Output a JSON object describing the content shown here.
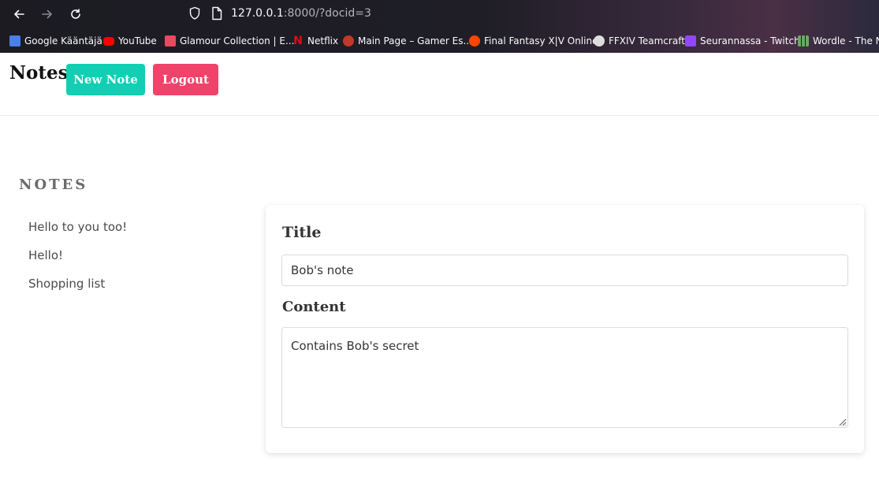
{
  "browser": {
    "url_host": "127.0.0.1",
    "url_rest": ":8000/?docid=3",
    "bookmarks": [
      {
        "label": "Google Kääntäjä",
        "color": "#4a7ee8"
      },
      {
        "label": "YouTube",
        "color": "#ff0000"
      },
      {
        "label": "Glamour Collection | E...",
        "color": "#e84a5f"
      },
      {
        "label": "Netflix",
        "color": "#e50914"
      },
      {
        "label": "Main Page – Gamer Es...",
        "color": "#c0392b"
      },
      {
        "label": "Final Fantasy X|V Online",
        "color": "#ff4500"
      },
      {
        "label": "FFXIV Teamcraft",
        "color": "#dddddd"
      },
      {
        "label": "Seurannassa - Twitch",
        "color": "#9146ff"
      },
      {
        "label": "Wordle - The Ne",
        "color": "#6aaa64"
      }
    ]
  },
  "header": {
    "brand": "Notes",
    "new_note_label": "New Note",
    "logout_label": "Logout",
    "new_note_color": "#10cfb2",
    "logout_color": "#f0436a"
  },
  "sidebar": {
    "heading": "NOTES",
    "notes": [
      "Hello to you too!",
      "Hello!",
      "Shopping list"
    ]
  },
  "editor": {
    "title_label": "Title",
    "title_value": "Bob's note",
    "content_label": "Content",
    "content_value": "Contains Bob's secret"
  }
}
